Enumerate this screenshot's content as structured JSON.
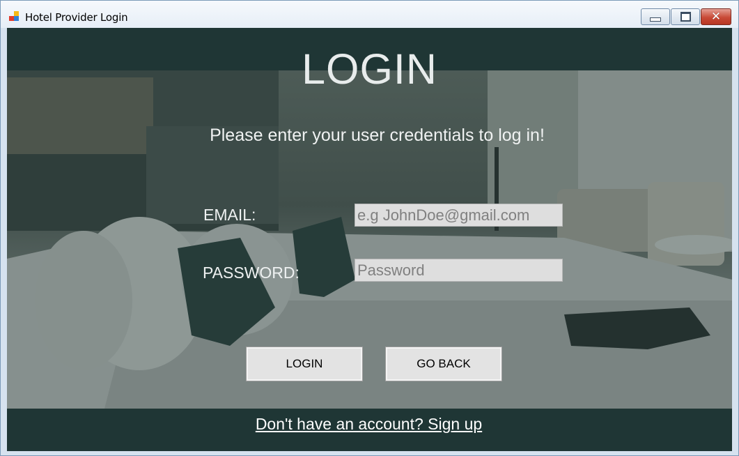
{
  "window": {
    "title": "Hotel Provider Login",
    "controls": {
      "minimize": "minimize",
      "maximize": "maximize",
      "close": "✕"
    }
  },
  "login": {
    "heading": "LOGIN",
    "subtitle": "Please enter your user credentials to log in!",
    "email_label": "EMAIL:",
    "email_value": "",
    "email_placeholder": "e.g JohnDoe@gmail.com",
    "password_label": "PASSWORD:",
    "password_value": "",
    "password_placeholder": "Password",
    "login_button": "LOGIN",
    "go_back_button": "GO BACK",
    "signup_link": "Don't have an account? Sign up"
  },
  "colors": {
    "band": "#1f3635",
    "text": "#e8ecec",
    "input_bg": "#dedede",
    "button_bg": "#e3e3e3"
  },
  "icons": {
    "app": "app-windows-form-icon"
  }
}
